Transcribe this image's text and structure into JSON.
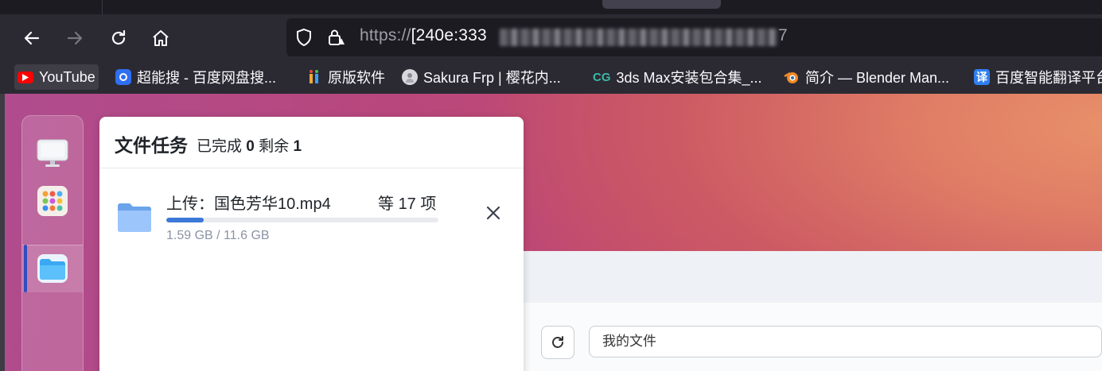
{
  "browser": {
    "url_prefix": "https://",
    "url_visible": "[240e:333",
    "url_tail": "7",
    "colors": {
      "chrome": "#2b2a33",
      "urlbar": "#1c1b22",
      "text": "#fbfbfe"
    }
  },
  "bookmarks": [
    {
      "label": "YouTube",
      "icon": "youtube-icon"
    },
    {
      "label": "超能搜 - 百度网盘搜...",
      "icon": "chaonengsou-icon"
    },
    {
      "label": "原版软件",
      "icon": "yuanban-icon"
    },
    {
      "label": "Sakura Frp | 樱花内...",
      "icon": "sakura-icon"
    },
    {
      "label": "3ds Max安装包合集_...",
      "icon": "cg-icon"
    },
    {
      "label": "简介 — Blender Man...",
      "icon": "blender-icon"
    },
    {
      "label": "百度智能翻译平台",
      "icon": "translate-icon",
      "glyph": "译"
    }
  ],
  "dock": {
    "items": [
      {
        "name": "monitor",
        "icon": "monitor-icon"
      },
      {
        "name": "apps",
        "icon": "apps-grid-icon"
      },
      {
        "name": "files",
        "icon": "folder-app-icon",
        "active": true
      }
    ]
  },
  "file_tasks": {
    "title": "文件任务",
    "completed_label": "已完成",
    "completed_count": "0",
    "remaining_label": "剩余",
    "remaining_count": "1",
    "task": {
      "name": "上传：国色芳华10.mp4",
      "count_prefix": "等",
      "count": "17",
      "count_suffix": "项",
      "progress": 0.137,
      "size": "1.59 GB / 11.6 GB"
    }
  },
  "file_browser": {
    "path": "我的文件"
  }
}
